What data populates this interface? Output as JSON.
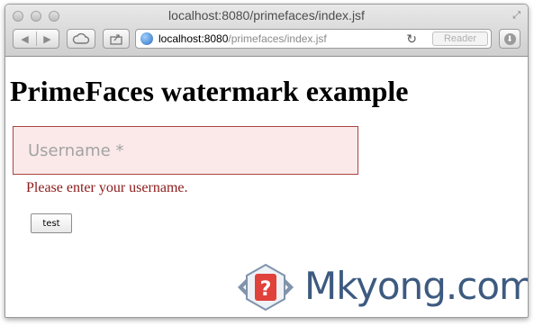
{
  "browser": {
    "title": "localhost:8080/primefaces/index.jsf",
    "address": {
      "host": "localhost:8080",
      "path": "/primefaces/index.jsf"
    },
    "reader_label": "Reader",
    "back_glyph": "◀",
    "forward_glyph": "▶",
    "reload_glyph": "↻",
    "icons": [
      "back-icon",
      "forward-icon",
      "cloud-icon",
      "share-icon",
      "globe-icon",
      "reload-icon",
      "download-icon",
      "fullscreen-icon"
    ]
  },
  "page": {
    "heading": "PrimeFaces watermark example",
    "username": {
      "value": "",
      "placeholder": "Username *"
    },
    "error_message": "Please enter your username.",
    "test_button": "test"
  },
  "watermark_logo": {
    "text": "Mkyong.com",
    "icon_glyph": "?"
  },
  "colors": {
    "error_text": "#8b1a1a",
    "error_border": "#a94442",
    "error_background": "#fbe9e9",
    "logo_text": "#3d5a80",
    "logo_accent": "#e0413a"
  }
}
